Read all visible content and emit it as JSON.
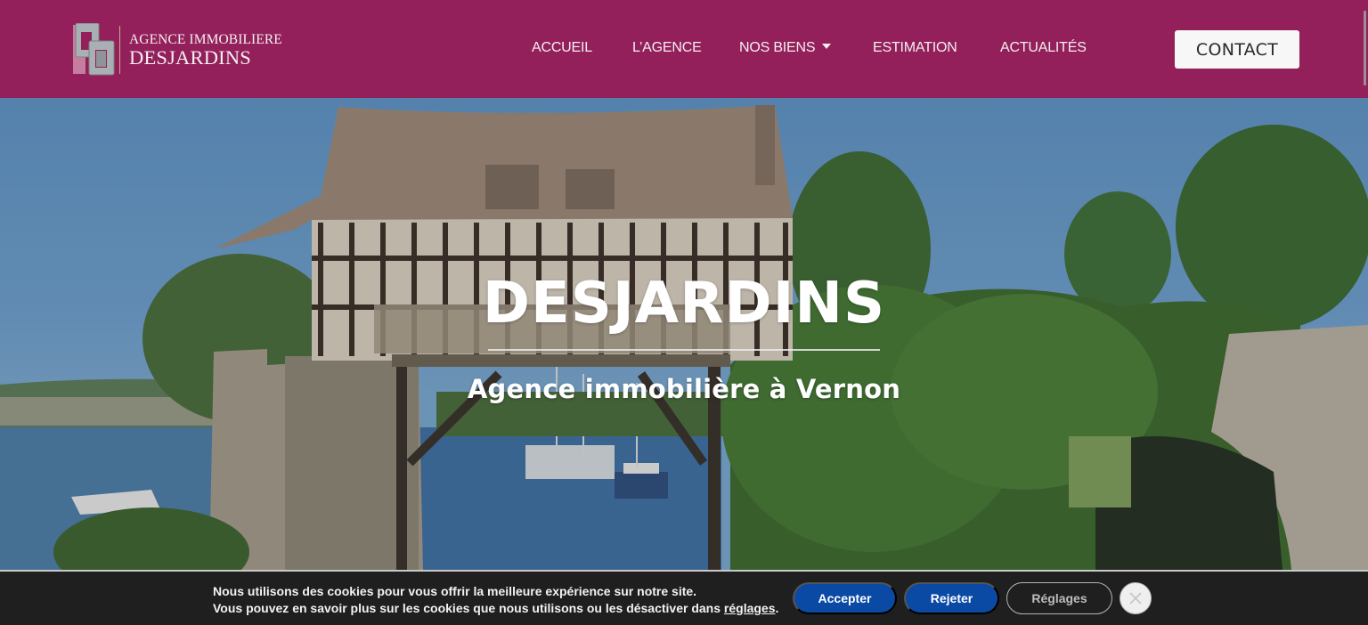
{
  "colors": {
    "header_bg": "#93205a",
    "cookie_bg": "#1f1f1f",
    "cookie_button_primary": "#0b4aa4",
    "contact_bg": "#f7f7f7"
  },
  "logo": {
    "line1": "AGENCE IMMOBILIERE",
    "line2": "DESJARDINS",
    "icon": "dd-monogram-icon"
  },
  "nav": {
    "items": [
      {
        "label": "ACCUEIL"
      },
      {
        "label": "L’AGENCE"
      },
      {
        "label": "NOS BIENS",
        "icon": "caret-down-icon"
      },
      {
        "label": "ESTIMATION"
      },
      {
        "label": "ACTUALITÉS"
      }
    ],
    "contact_label": "CONTACT"
  },
  "hero": {
    "title": "DESJARDINS",
    "subtitle": "Agence immobilière à Vernon",
    "image_alt": "Vieux moulin à colombages sur la Seine"
  },
  "cookie": {
    "line1": "Nous utilisons des cookies pour vous offrir la meilleure expérience sur notre site.",
    "line2_prefix": "Vous pouvez en savoir plus sur les cookies que nous utilisons ou les désactiver dans ",
    "line2_link": "réglages",
    "line2_suffix": ".",
    "accept_label": "Accepter",
    "reject_label": "Rejeter",
    "settings_label": "Réglages",
    "close_icon": "close-icon"
  }
}
